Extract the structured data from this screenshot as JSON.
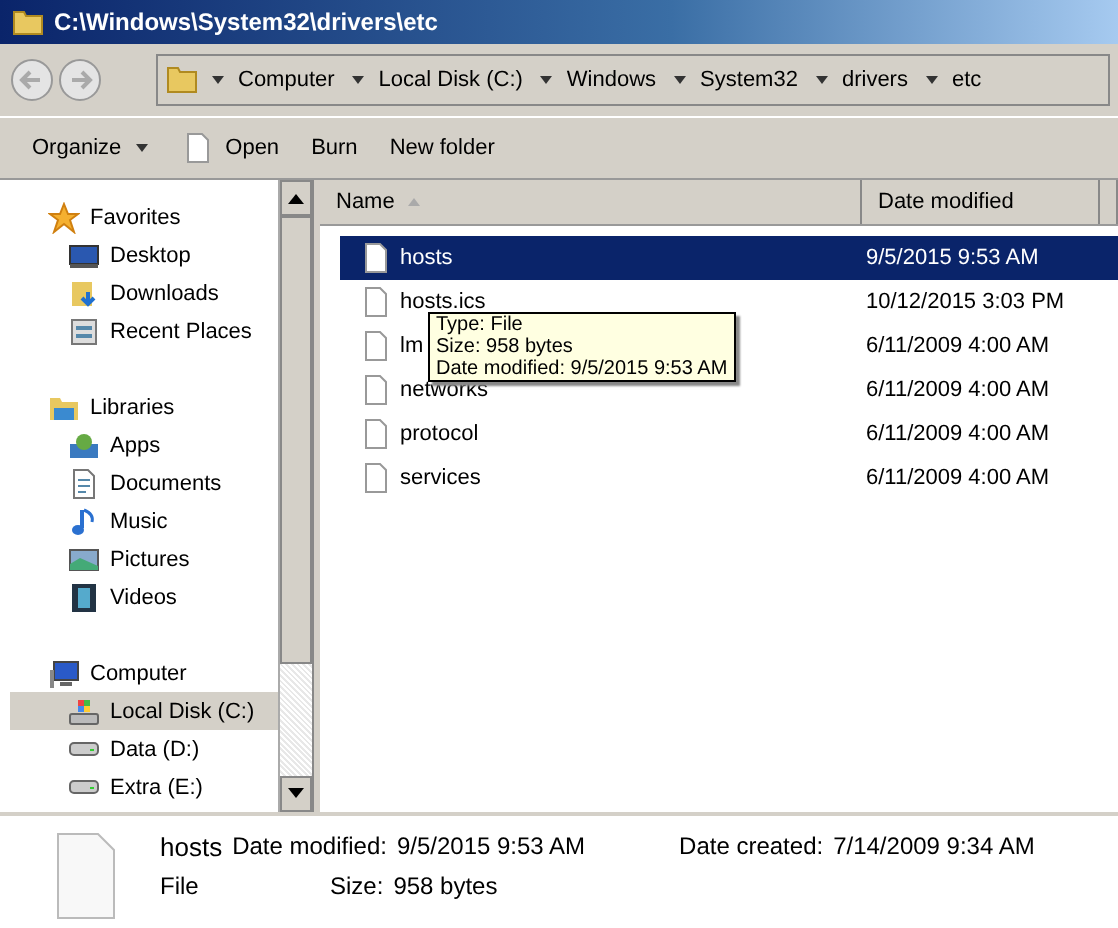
{
  "window": {
    "title": "C:\\Windows\\System32\\drivers\\etc"
  },
  "address": {
    "crumbs": [
      "Computer",
      "Local Disk (C:)",
      "Windows",
      "System32",
      "drivers",
      "etc"
    ]
  },
  "toolbar": [
    {
      "label": "Organize",
      "kind": "menu"
    },
    {
      "label": "Open",
      "kind": "file"
    },
    {
      "label": "Burn",
      "kind": "plain"
    },
    {
      "label": "New folder",
      "kind": "plain"
    }
  ],
  "sidebar": {
    "sections": [
      {
        "label": "Favorites",
        "kind": "star",
        "items": [
          {
            "label": "Desktop",
            "kind": "desktop",
            "selected": false
          },
          {
            "label": "Downloads",
            "kind": "downloads",
            "selected": false
          },
          {
            "label": "Recent Places",
            "kind": "recent",
            "selected": false
          }
        ]
      },
      {
        "label": "Libraries",
        "kind": "library",
        "items": [
          {
            "label": "Apps",
            "kind": "apps",
            "selected": false
          },
          {
            "label": "Documents",
            "kind": "documents",
            "selected": false
          },
          {
            "label": "Music",
            "kind": "music",
            "selected": false
          },
          {
            "label": "Pictures",
            "kind": "pictures",
            "selected": false
          },
          {
            "label": "Videos",
            "kind": "videos",
            "selected": false
          }
        ]
      },
      {
        "label": "Computer",
        "kind": "computer",
        "items": [
          {
            "label": "Local Disk (C:)",
            "kind": "system-drive",
            "selected": true
          },
          {
            "label": "Data (D:)",
            "kind": "drive",
            "selected": false
          },
          {
            "label": "Extra (E:)",
            "kind": "drive",
            "selected": false
          }
        ]
      }
    ]
  },
  "table": {
    "columns": [
      "Name",
      "Date modified"
    ],
    "rows": [
      {
        "name": "hosts",
        "date": "9/5/2015 9:53 AM",
        "selected": true
      },
      {
        "name": "hosts.ics",
        "date": "10/12/2015 3:03 PM",
        "selected": false
      },
      {
        "name": "lm",
        "date": "6/11/2009 4:00 AM",
        "selected": false
      },
      {
        "name": "networks",
        "date": "6/11/2009 4:00 AM",
        "selected": false
      },
      {
        "name": "protocol",
        "date": "6/11/2009 4:00 AM",
        "selected": false
      },
      {
        "name": "services",
        "date": "6/11/2009 4:00 AM",
        "selected": false
      }
    ]
  },
  "tooltip": {
    "lines": [
      "Type: File",
      "Size: 958 bytes",
      "Date modified: 9/5/2015 9:53 AM"
    ]
  },
  "details": {
    "name": "hosts",
    "type": "File",
    "modified_label": "Date modified:",
    "modified": "9/5/2015 9:53 AM",
    "size_label": "Size:",
    "size": "958 bytes",
    "created_label": "Date created:",
    "created": "7/14/2009 9:34 AM"
  }
}
